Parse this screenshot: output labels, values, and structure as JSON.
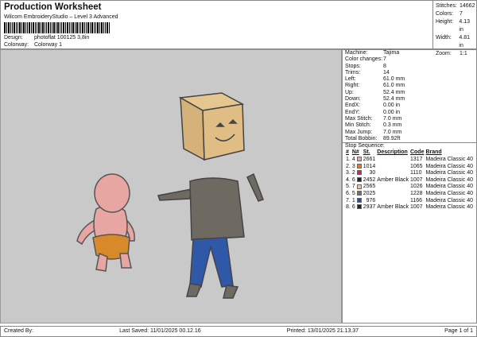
{
  "header": {
    "title": "Production Worksheet",
    "subtitle": "Wilcom EmbroideryStudio – Level 3 Advanced",
    "design_label": "Design:",
    "design_value": "photoflat 100125 3,8in",
    "colorway_label": "Colorway:",
    "colorway_value": "Colorway 1"
  },
  "stats": [
    {
      "k": "Stitches:",
      "v": "14662"
    },
    {
      "k": "Colors:",
      "v": "7"
    },
    {
      "k": "Height:",
      "v": "4.13 in"
    },
    {
      "k": "Width:",
      "v": "4.81 in"
    },
    {
      "k": "Zoom:",
      "v": "1:1"
    }
  ],
  "info": [
    {
      "k": "Machine:",
      "v": "Tajima"
    },
    {
      "k": "Color changes:",
      "v": "7"
    },
    {
      "k": "Stops:",
      "v": "8"
    },
    {
      "k": "Trims:",
      "v": "14"
    },
    {
      "k": "Left:",
      "v": "61.0 mm"
    },
    {
      "k": "Right:",
      "v": "61.0 mm"
    },
    {
      "k": "Up:",
      "v": "52.4 mm"
    },
    {
      "k": "Down:",
      "v": "52.4 mm"
    },
    {
      "k": "EndX:",
      "v": "0.00 in"
    },
    {
      "k": "EndY:",
      "v": "0.00 in"
    },
    {
      "k": "Max Stitch:",
      "v": "7.0 mm"
    },
    {
      "k": "Min Stitch:",
      "v": "0.3 mm"
    },
    {
      "k": "Max Jump:",
      "v": "7.0 mm"
    },
    {
      "k": "Total Bobbin:",
      "v": "89.92ft"
    }
  ],
  "sequence": {
    "title": "Stop Sequence:",
    "headers": [
      "#",
      "N#",
      "St.",
      "Description",
      "Code",
      "Brand"
    ],
    "rows": [
      {
        "n": "1.",
        "num": "4",
        "color": "#e8a6a2",
        "st": "2661",
        "desc": "",
        "code": "1317",
        "brand": "Madeira Classic 40"
      },
      {
        "n": "2.",
        "num": "3",
        "color": "#e07a2a",
        "st": "1014",
        "desc": "",
        "code": "1065",
        "brand": "Madeira Classic 40"
      },
      {
        "n": "3.",
        "num": "2",
        "color": "#c8286a",
        "st": "30",
        "desc": "",
        "code": "1110",
        "brand": "Madeira Classic 40"
      },
      {
        "n": "4.",
        "num": "6",
        "color": "#252525",
        "st": "2452",
        "desc": "Amber Black",
        "code": "1007",
        "brand": "Madeira Classic 40"
      },
      {
        "n": "5.",
        "num": "7",
        "color": "#f0c096",
        "st": "2565",
        "desc": "",
        "code": "1026",
        "brand": "Madeira Classic 40"
      },
      {
        "n": "6.",
        "num": "5",
        "color": "#7a6e66",
        "st": "2025",
        "desc": "",
        "code": "1228",
        "brand": "Madeira Classic 40"
      },
      {
        "n": "7.",
        "num": "1",
        "color": "#2a4aa0",
        "st": "976",
        "desc": "",
        "code": "1166",
        "brand": "Madeira Classic 40"
      },
      {
        "n": "8.",
        "num": "6",
        "color": "#252525",
        "st": "2937",
        "desc": "Amber Black",
        "code": "1007",
        "brand": "Madeira Classic 40"
      }
    ]
  },
  "footer": {
    "created": "Created By:",
    "saved": "Last Saved: 11/01/2025 00.12.16",
    "printed": "Printed: 13/01/2025 21.13.37",
    "page": "Page 1 of 1"
  }
}
